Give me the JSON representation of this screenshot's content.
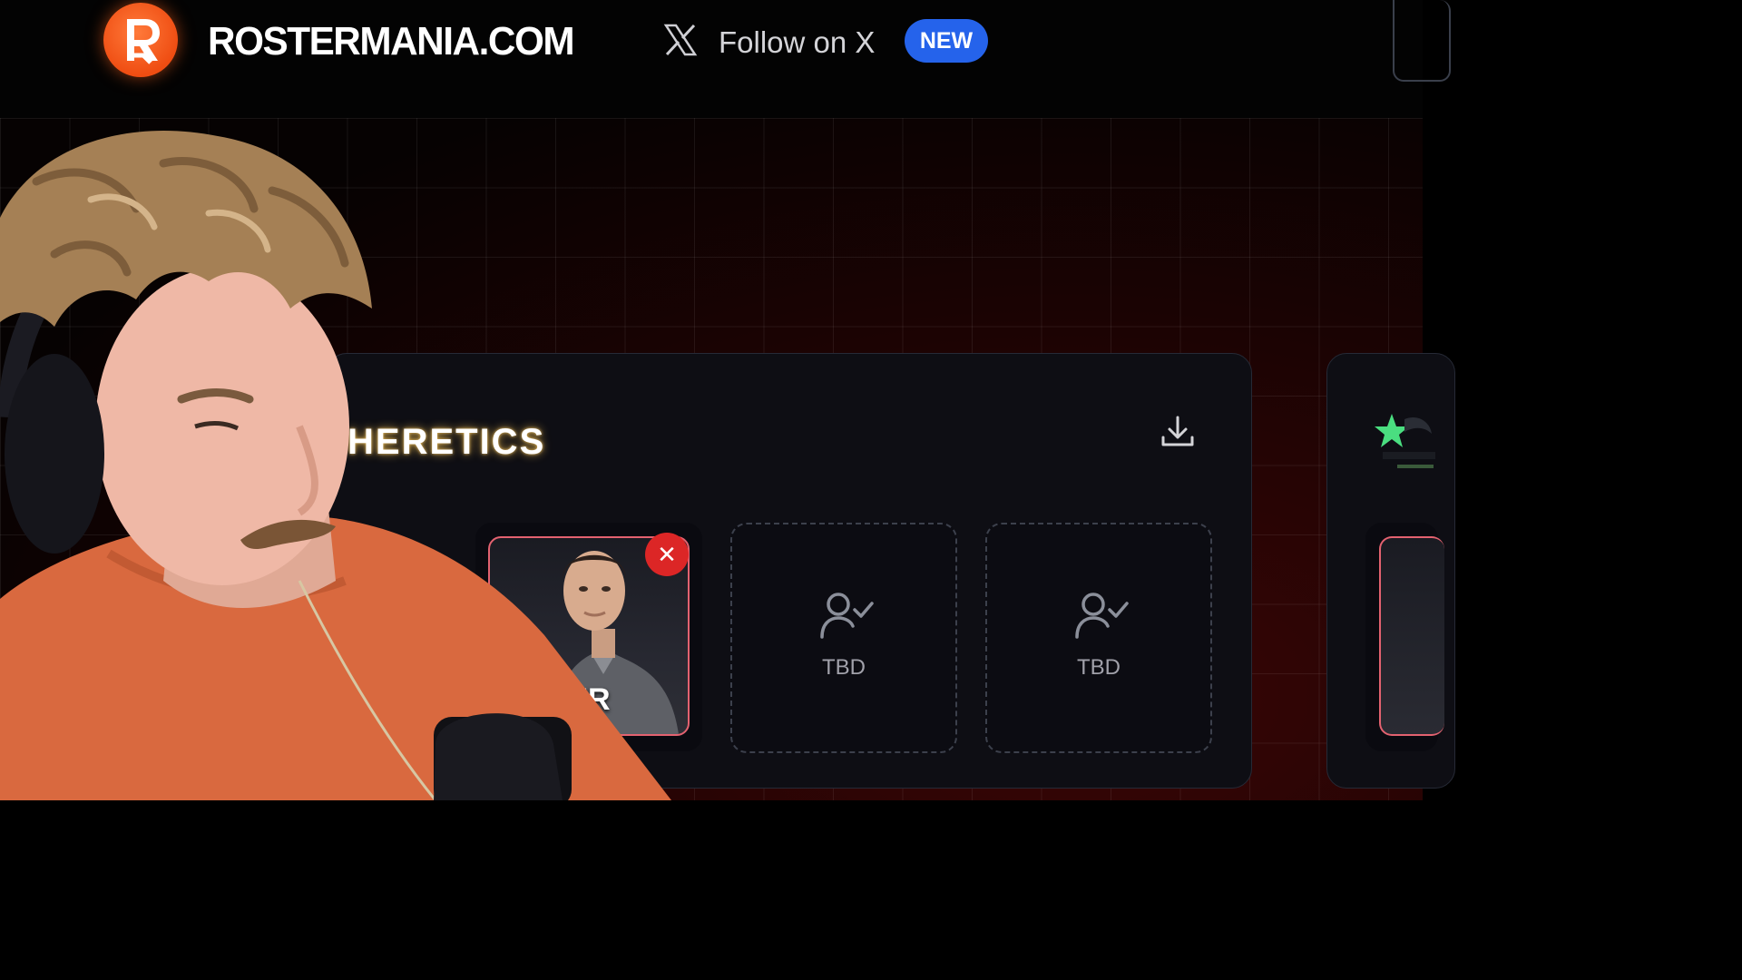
{
  "header": {
    "brand": "ROSTERMANIA.COM",
    "follow_label": "Follow on X",
    "new_badge": "NEW"
  },
  "team": {
    "name": "HERETICS",
    "player_name_visible": "ER",
    "slots": [
      {
        "label": "TBD"
      },
      {
        "label": "TBD"
      }
    ]
  },
  "icons": {
    "logo": "rostermania-logo-icon",
    "x": "x-logo-icon",
    "download": "download-icon",
    "remove": "close-icon",
    "tbd": "user-check-icon"
  },
  "colors": {
    "brand_orange": "#ef4d12",
    "new_badge": "#2563eb",
    "remove_red": "#dc2626",
    "player_border": "#e36270"
  }
}
